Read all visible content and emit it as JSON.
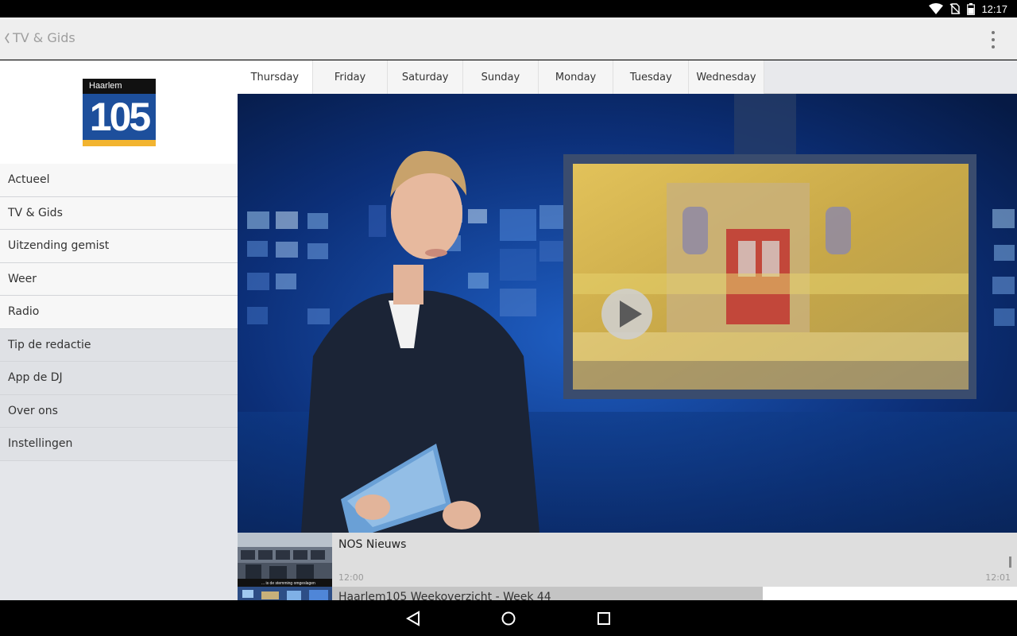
{
  "status_bar": {
    "time": "12:17"
  },
  "app_bar": {
    "title": "TV & Gids"
  },
  "logo": {
    "top_text": "Haarlem",
    "number": "105"
  },
  "sidebar": {
    "items": [
      {
        "label": "Actueel"
      },
      {
        "label": "TV & Gids"
      },
      {
        "label": "Uitzending gemist"
      },
      {
        "label": "Weer"
      },
      {
        "label": "Radio"
      },
      {
        "label": "Tip de redactie"
      },
      {
        "label": "App de DJ"
      },
      {
        "label": "Over ons"
      },
      {
        "label": "Instellingen"
      }
    ]
  },
  "tabs": [
    {
      "label": "Thursday",
      "active": true
    },
    {
      "label": "Friday"
    },
    {
      "label": "Saturday"
    },
    {
      "label": "Sunday"
    },
    {
      "label": "Monday"
    },
    {
      "label": "Tuesday"
    },
    {
      "label": "Wednesday"
    }
  ],
  "playlist": {
    "items": [
      {
        "title": "NOS Nieuws",
        "start": "12:00",
        "end": "12:01",
        "thumb_caption": "... is de stemming omgeslagen"
      },
      {
        "title": "Haarlem105 Weekoverzicht - Week 44"
      }
    ]
  },
  "colors": {
    "logo_blue": "#1d4f9c",
    "logo_yellow": "#f2b430",
    "studio_blue": "#0b2a66"
  }
}
